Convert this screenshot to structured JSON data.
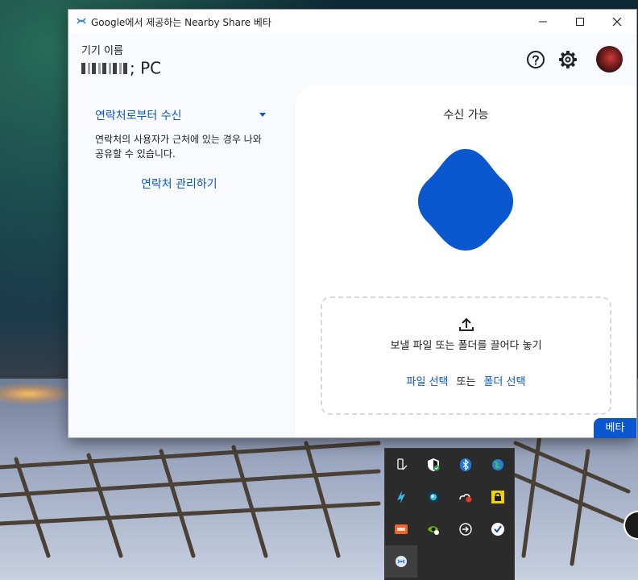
{
  "window": {
    "title": "Google에서 제공하는 Nearby Share 베타"
  },
  "header": {
    "device_label": "기기 이름",
    "device_name_suffix": "; PC",
    "help_icon": "help-circle-icon",
    "settings_icon": "gear-icon"
  },
  "left": {
    "visibility_option": "연락처로부터 수신",
    "visibility_description": "연락처의 사용자가 근처에 있는 경우 나와 공유할 수 있습니다.",
    "manage_contacts": "연락처 관리하기"
  },
  "right": {
    "status": "수신 가능",
    "drop_text": "보낼 파일 또는 폴더를 끌어다 놓기",
    "select_file": "파일 선택",
    "or": "또는",
    "select_folder": "폴더 선택"
  },
  "badge": {
    "label": "베타"
  },
  "colors": {
    "accent": "#0b57d0",
    "panel_bg": "#f8fafd",
    "tray_bg": "#2b2b2b"
  },
  "tray": {
    "icons": [
      "usb-eject-icon",
      "windows-security-icon",
      "bluetooth-icon",
      "globe-icon",
      "arrow-app-icon",
      "orb-icon",
      "cloud-sync-icon",
      "lock-icon",
      "office-icon",
      "nvidia-icon",
      "arrow-circle-icon",
      "checkmark-icon",
      "nearby-share-icon"
    ]
  }
}
